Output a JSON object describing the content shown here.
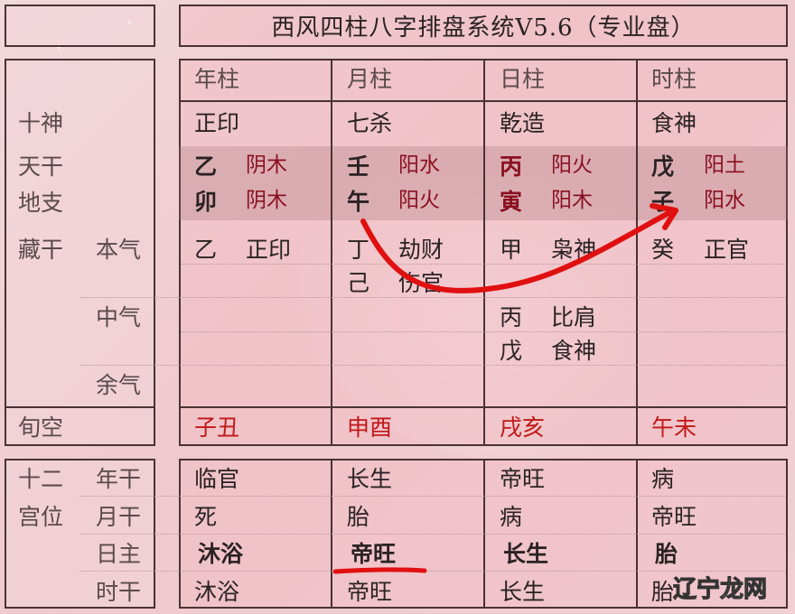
{
  "title": "西风四柱八字排盘系统V5.6（专业盘）",
  "columns": [
    "年柱",
    "月柱",
    "日柱",
    "时柱"
  ],
  "row_labels": {
    "shishen": "十神",
    "tiangan": "天干",
    "dizhi": "地支",
    "canggan": "藏干",
    "benqi": "本气",
    "zhongqi": "中气",
    "yuqi": "余气",
    "xunkong": "旬空",
    "shier_1": "十二",
    "shier_2": "宫位",
    "nian_gan": "年干",
    "yue_gan": "月干",
    "ri_zhu": "日主",
    "shi_gan": "时干"
  },
  "pillars": [
    {
      "shishen": "正印",
      "gan": "乙",
      "gan_wx": "阴木",
      "zhi": "卯",
      "zhi_wx": "阴木",
      "canggan": [
        [
          "乙",
          "正印"
        ]
      ],
      "xunkong": "子丑",
      "changsheng": [
        "临官",
        "死",
        "沐浴",
        "沐浴"
      ]
    },
    {
      "shishen": "七杀",
      "gan": "壬",
      "gan_wx": "阳水",
      "zhi": "午",
      "zhi_wx": "阳火",
      "canggan": [
        [
          "丁",
          "劫财"
        ],
        [
          "己",
          "伤官"
        ]
      ],
      "xunkong": "申酉",
      "changsheng": [
        "长生",
        "胎",
        "帝旺",
        "帝旺"
      ]
    },
    {
      "shishen": "乾造",
      "gan": "丙",
      "gan_wx": "阳火",
      "zhi": "寅",
      "zhi_wx": "阳木",
      "canggan": [
        [
          "甲",
          "枭神"
        ],
        [
          "丙",
          "比肩"
        ],
        [
          "戊",
          "食神"
        ]
      ],
      "xunkong": "戌亥",
      "changsheng": [
        "帝旺",
        "病",
        "长生",
        "长生"
      ]
    },
    {
      "shishen": "食神",
      "gan": "戊",
      "gan_wx": "阳土",
      "zhi": "子",
      "zhi_wx": "阳水",
      "canggan": [
        [
          "癸",
          "正官"
        ]
      ],
      "xunkong": "午未",
      "changsheng": [
        "病",
        "帝旺",
        "胎",
        "胎"
      ]
    }
  ],
  "annotations": {
    "arrow": "red hand-drawn arrow from 午 (month branch) to 子 (hour branch)",
    "underline": "red underline under 帝旺 (month pillar, 日主 row)"
  },
  "watermark": {
    "part1": "辽宁",
    "part2": "龙网"
  },
  "colors": {
    "accent_red": "#c01818",
    "wuxing_red": "#8a1020",
    "border": "#4a3234"
  }
}
